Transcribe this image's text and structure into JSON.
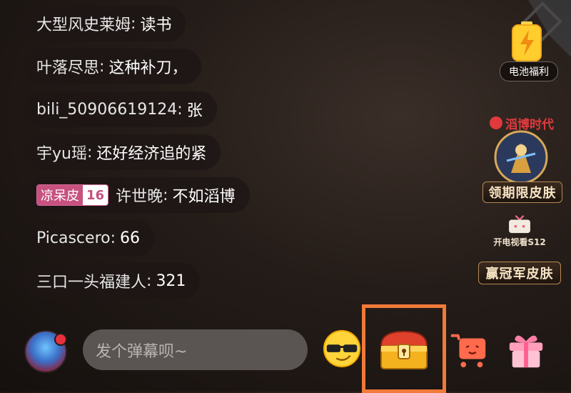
{
  "chat": {
    "messages": [
      {
        "user": "大型风史莱姆",
        "sep": ":",
        "text": "读书"
      },
      {
        "user": "叶落尽思",
        "sep": ":",
        "text": "这种补刀，"
      },
      {
        "user": "bili_50906619124",
        "sep": ":",
        "text": "张"
      },
      {
        "user": "宇yu瑶",
        "sep": ":",
        "text": "还好经济追的紧"
      },
      {
        "badge_name": "凉呆皮",
        "badge_level": "16",
        "user": "许世晚",
        "sep": ":",
        "text": "不如滔博"
      },
      {
        "user": "Picascero",
        "sep": ":",
        "text": "66"
      },
      {
        "user": "三口一头福建人",
        "sep": ":",
        "text": "321"
      }
    ]
  },
  "side": {
    "battery_label": "电池福利",
    "era_logo": "滔博时代",
    "limited_skin_label": "领期限皮肤",
    "tv_caption": "开电视看S12",
    "champion_skin_label": "赢冠军皮肤"
  },
  "bottom": {
    "input_placeholder": "发个弹幕呗~"
  },
  "colors": {
    "highlight": "#f07a3a",
    "badge": "#c7517f"
  }
}
